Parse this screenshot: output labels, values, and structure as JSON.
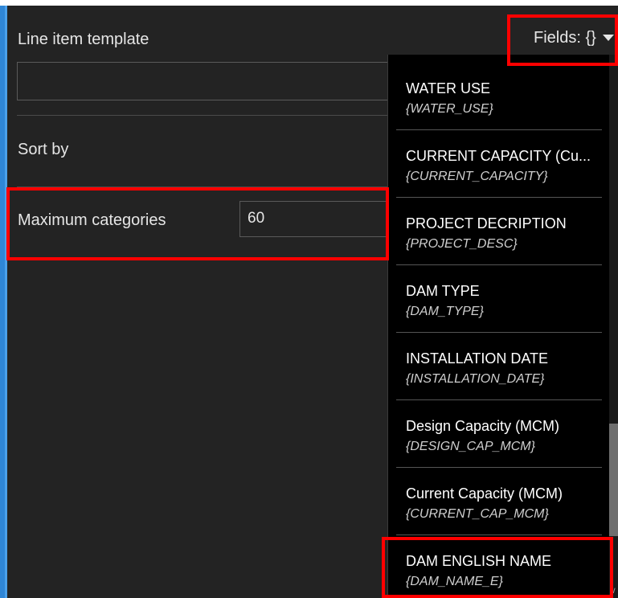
{
  "line_item_template": {
    "label": "Line item template",
    "value": ""
  },
  "sort_by": {
    "label": "Sort by"
  },
  "max_categories": {
    "label": "Maximum categories",
    "value": "60"
  },
  "fields_button": {
    "label": "Fields: {}"
  },
  "field_list": [
    {
      "name": "WATER USE",
      "token": "{WATER_USE}"
    },
    {
      "name": "CURRENT CAPACITY (Cu...",
      "token": "{CURRENT_CAPACITY}"
    },
    {
      "name": "PROJECT DECRIPTION",
      "token": "{PROJECT_DESC}"
    },
    {
      "name": "DAM TYPE",
      "token": "{DAM_TYPE}"
    },
    {
      "name": "INSTALLATION DATE",
      "token": "{INSTALLATION_DATE}"
    },
    {
      "name": "Design Capacity (MCM)",
      "token": "{DESIGN_CAP_MCM}"
    },
    {
      "name": "Current Capacity (MCM)",
      "token": "{CURRENT_CAP_MCM}"
    },
    {
      "name": "DAM ENGLISH NAME",
      "token": "{DAM_NAME_E}"
    }
  ],
  "colors": {
    "background": "#232323",
    "dropdown_bg": "#000000",
    "highlight": "#ff0000",
    "accent": "#2f86d6"
  },
  "icons": {
    "fields_caret": "caret-down-icon",
    "scroll_arrow": "chevron-down-icon"
  }
}
